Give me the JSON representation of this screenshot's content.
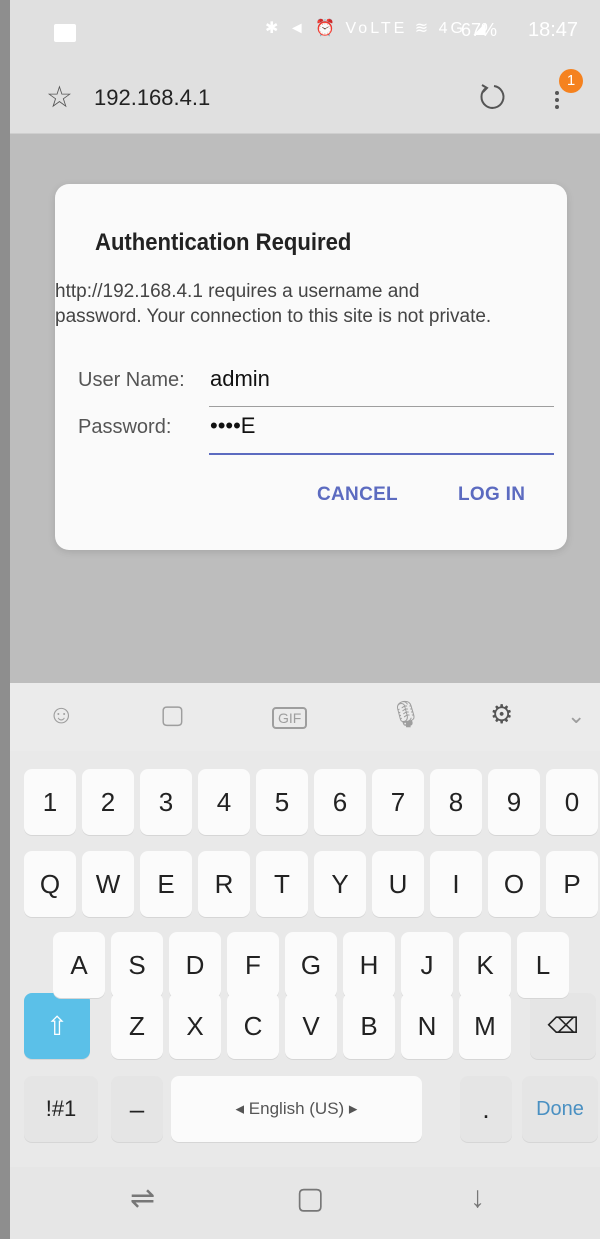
{
  "status_bar": {
    "icons": "✱ ◄ ⏰ VoLTE ≋ 4G ◢",
    "battery": "67%",
    "time": "18:47"
  },
  "browser": {
    "url": "192.168.4.1",
    "notification_count": "1"
  },
  "dialog": {
    "title": "Authentication Required",
    "message": "http://192.168.4.1 requires a username and password. Your connection to this site is not private.",
    "username_label": "User Name:",
    "username_value": "admin",
    "password_label": "Password:",
    "password_value": "••••E",
    "cancel_label": "CANCEL",
    "login_label": "LOG IN"
  },
  "keyboard": {
    "number_row": [
      "1",
      "2",
      "3",
      "4",
      "5",
      "6",
      "7",
      "8",
      "9",
      "0"
    ],
    "row1": [
      "Q",
      "W",
      "E",
      "R",
      "T",
      "Y",
      "U",
      "I",
      "O",
      "P"
    ],
    "row2": [
      "A",
      "S",
      "D",
      "F",
      "G",
      "H",
      "J",
      "K",
      "L"
    ],
    "row3": [
      "Z",
      "X",
      "C",
      "V",
      "B",
      "N",
      "M"
    ],
    "symbols_label": "!#1",
    "dash_label": "–",
    "space_label": "◂  English (US)  ▸",
    "period_label": ".",
    "done_label": "Done",
    "accent_color": "#5bc0e8"
  },
  "colors": {
    "link_blue": "#5c6bc0",
    "badge_orange": "#f5821f"
  }
}
